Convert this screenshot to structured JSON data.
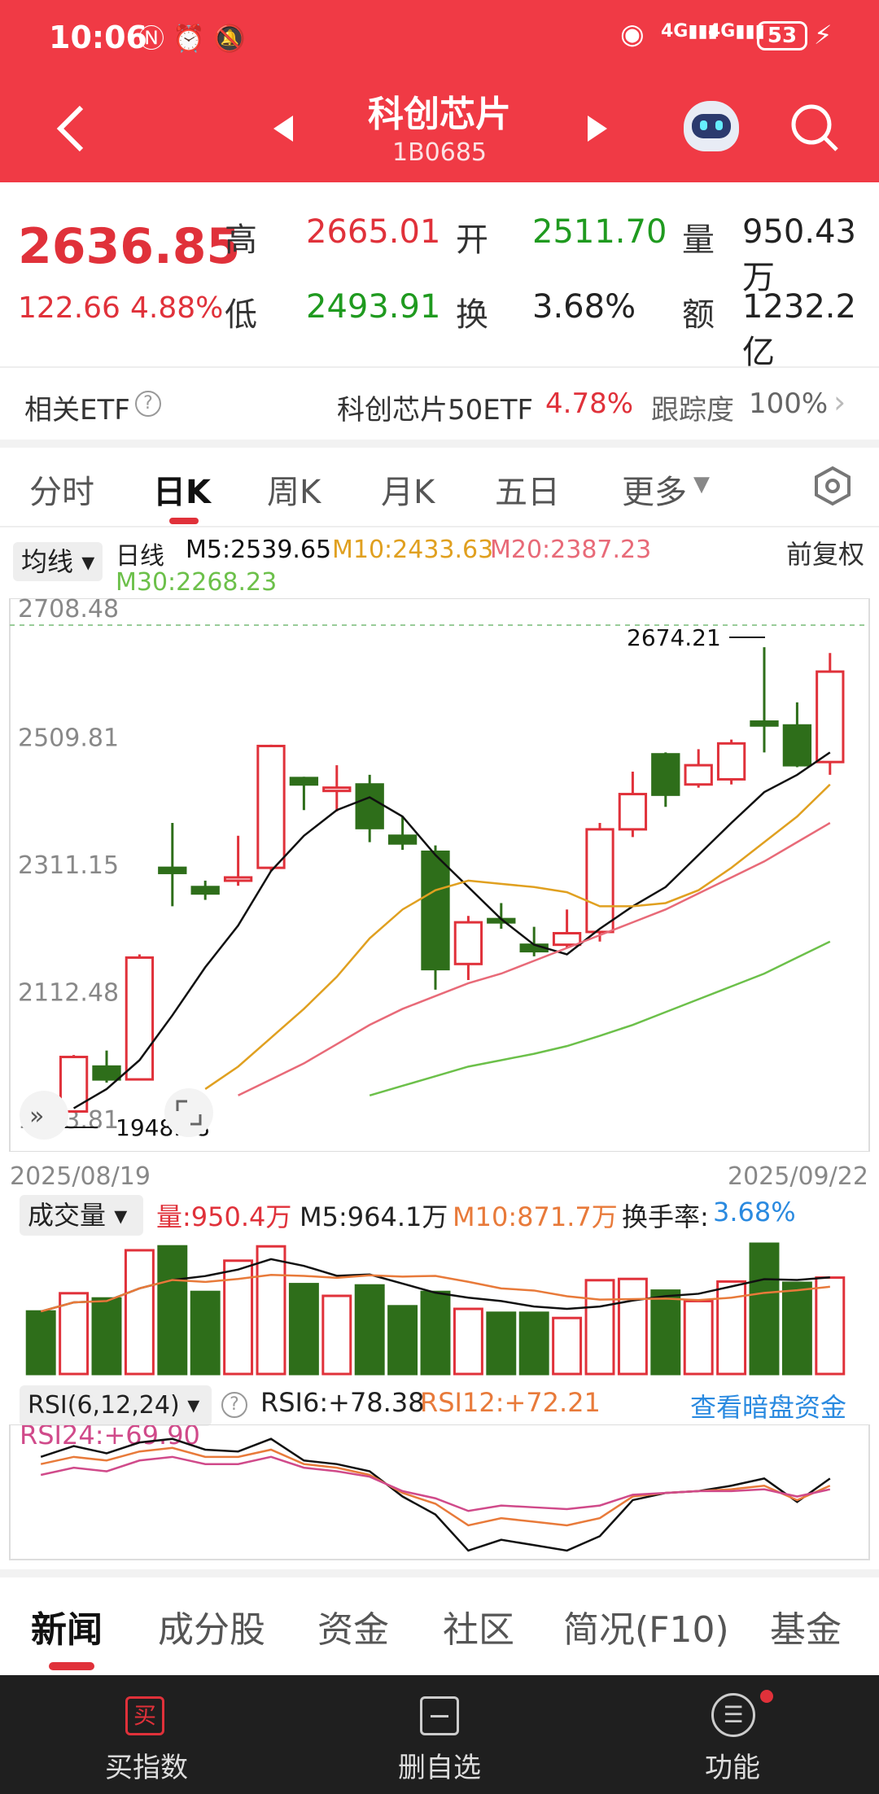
{
  "status": {
    "time": "10:06",
    "battery": "53",
    "net1": "4G",
    "net2": "4G"
  },
  "header": {
    "title": "科创芯片",
    "code": "1B0685",
    "prev_icon": "triangle-left-icon",
    "next_icon": "triangle-right-icon"
  },
  "quote": {
    "price": "2636.85",
    "change": "122.66",
    "pct": "4.88%",
    "rows": [
      [
        {
          "l": "高",
          "v": "2665.01",
          "c": "red"
        },
        {
          "l": "开",
          "v": "2511.70",
          "c": "green"
        },
        {
          "l": "量",
          "v": "950.43万",
          "c": "dark"
        }
      ],
      [
        {
          "l": "低",
          "v": "2493.91",
          "c": "green"
        },
        {
          "l": "换",
          "v": "3.68%",
          "c": "dark"
        },
        {
          "l": "额",
          "v": "1232.2亿",
          "c": "dark"
        }
      ]
    ]
  },
  "etf": {
    "label": "相关ETF",
    "name": "科创芯片50ETF",
    "pct": "4.78%",
    "track_label": "跟踪度",
    "track": "100%"
  },
  "tabs": [
    "分时",
    "日K",
    "周K",
    "月K",
    "五日",
    "更多"
  ],
  "ma": {
    "dropdown": "均线",
    "type": "日线",
    "m5": "M5:2539.65",
    "m10": "M10:2433.63",
    "m20": "M20:2387.23",
    "m30": "M30:2268.23",
    "adjust": "前复权"
  },
  "colors": {
    "up": "#e0313a",
    "down": "#2e6e1a",
    "m5": "#111111",
    "m10": "#e0a020",
    "m20": "#e86a78",
    "m30": "#6cc04a",
    "brand": "#f03a45"
  },
  "chart_data": {
    "type": "candlestick",
    "dates": [
      "2025/08/19",
      "2025/09/22"
    ],
    "ylim": [
      1913.81,
      2708.48
    ],
    "yticks": [
      "2708.48",
      "2509.81",
      "2311.15",
      "2112.48",
      "1913.81"
    ],
    "high_label": "2674.21",
    "low_label": "1948.08",
    "candles": [
      {
        "o": 1960,
        "c": 1952,
        "h": 1970,
        "l": 1945
      },
      {
        "o": 1950,
        "c": 2035,
        "h": 2038,
        "l": 1948
      },
      {
        "o": 2020,
        "c": 2000,
        "h": 2045,
        "l": 1995
      },
      {
        "o": 2000,
        "c": 2190,
        "h": 2195,
        "l": 1999
      },
      {
        "o": 2330,
        "c": 2322,
        "h": 2400,
        "l": 2270
      },
      {
        "o": 2300,
        "c": 2290,
        "h": 2310,
        "l": 2280
      },
      {
        "o": 2310,
        "c": 2315,
        "h": 2380,
        "l": 2302
      },
      {
        "o": 2330,
        "c": 2520,
        "h": 2522,
        "l": 2325
      },
      {
        "o": 2470,
        "c": 2460,
        "h": 2472,
        "l": 2420
      },
      {
        "o": 2450,
        "c": 2455,
        "h": 2490,
        "l": 2418
      },
      {
        "o": 2460,
        "c": 2392,
        "h": 2475,
        "l": 2370
      },
      {
        "o": 2380,
        "c": 2368,
        "h": 2410,
        "l": 2358
      },
      {
        "o": 2355,
        "c": 2172,
        "h": 2365,
        "l": 2140
      },
      {
        "o": 2180,
        "c": 2245,
        "h": 2255,
        "l": 2155
      },
      {
        "o": 2250,
        "c": 2245,
        "h": 2275,
        "l": 2235
      },
      {
        "o": 2210,
        "c": 2200,
        "h": 2238,
        "l": 2192
      },
      {
        "o": 2210,
        "c": 2228,
        "h": 2265,
        "l": 2205
      },
      {
        "o": 2230,
        "c": 2390,
        "h": 2400,
        "l": 2215
      },
      {
        "o": 2390,
        "c": 2445,
        "h": 2480,
        "l": 2378
      },
      {
        "o": 2507,
        "c": 2444,
        "h": 2510,
        "l": 2425
      },
      {
        "o": 2460,
        "c": 2490,
        "h": 2515,
        "l": 2455
      },
      {
        "o": 2468,
        "c": 2524,
        "h": 2530,
        "l": 2460
      },
      {
        "o": 2558,
        "c": 2552,
        "h": 2674,
        "l": 2510
      },
      {
        "o": 2552,
        "c": 2490,
        "h": 2588,
        "l": 2487
      },
      {
        "o": 2495,
        "c": 2636,
        "h": 2665,
        "l": 2475
      }
    ],
    "ma5": [
      null,
      1955,
      1985,
      2030,
      2100,
      2175,
      2240,
      2325,
      2380,
      2420,
      2440,
      2410,
      2350,
      2300,
      2250,
      2210,
      2195,
      2235,
      2270,
      2300,
      2350,
      2400,
      2448,
      2475,
      2510
    ],
    "ma10": [
      null,
      null,
      null,
      null,
      null,
      1985,
      2020,
      2065,
      2110,
      2160,
      2220,
      2265,
      2295,
      2310,
      2305,
      2300,
      2292,
      2270,
      2270,
      2275,
      2295,
      2330,
      2370,
      2410,
      2460
    ],
    "ma20": [
      null,
      null,
      null,
      null,
      null,
      null,
      1975,
      2000,
      2025,
      2055,
      2085,
      2110,
      2130,
      2150,
      2165,
      2185,
      2205,
      2225,
      2245,
      2265,
      2290,
      2315,
      2340,
      2370,
      2400
    ],
    "ma30": [
      null,
      null,
      null,
      null,
      null,
      null,
      null,
      null,
      null,
      null,
      1975,
      1990,
      2005,
      2020,
      2030,
      2040,
      2052,
      2068,
      2085,
      2105,
      2125,
      2145,
      2165,
      2190,
      2215
    ]
  },
  "volume": {
    "dropdown": "成交量",
    "vol": "量:950.4万",
    "m5": "M5:964.1万",
    "m10": "M10:871.7万",
    "turnover_label": "换手率:",
    "turnover": "3.68%",
    "bars": [
      0.48,
      0.62,
      0.58,
      0.95,
      0.98,
      0.63,
      0.87,
      0.98,
      0.69,
      0.6,
      0.68,
      0.52,
      0.63,
      0.5,
      0.47,
      0.47,
      0.43,
      0.72,
      0.73,
      0.64,
      0.56,
      0.71,
      1.0,
      0.7,
      0.74
    ]
  },
  "rsi": {
    "dropdown": "RSI(6,12,24)",
    "rsi6": "RSI6:+78.38",
    "rsi12": "RSI12:+72.21",
    "rsi24": "RSI24:+69.90",
    "link": "查看暗盘资金"
  },
  "news_tabs": [
    "新闻",
    "成分股",
    "资金",
    "社区",
    "简况(F10)",
    "基金"
  ],
  "bottom": {
    "buy": "买指数",
    "del": "删自选",
    "func": "功能",
    "buy_icon": "buy-icon",
    "del_icon": "minus-box-icon",
    "func_icon": "menu-circle-icon"
  }
}
